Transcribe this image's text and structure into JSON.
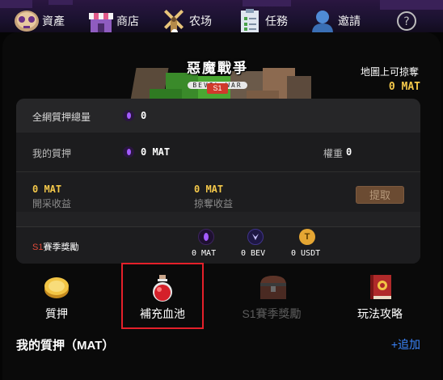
{
  "nav": {
    "items": [
      {
        "label": "資產",
        "icon": "skull-icon"
      },
      {
        "label": "商店",
        "icon": "shop-icon"
      },
      {
        "label": "农场",
        "icon": "windmill-icon"
      },
      {
        "label": "任務",
        "icon": "checklist-icon"
      },
      {
        "label": "邀請",
        "icon": "user-icon"
      }
    ],
    "active_index": 2,
    "help_icon": "help-icon"
  },
  "map": {
    "title": "惡魔戰爭",
    "subtitle": "BEVIL WAR",
    "season_tag": "S1"
  },
  "plunder": {
    "label": "地圖上可掠奪",
    "value": "0 MAT"
  },
  "stats": {
    "total_stake_label": "全網質押總量",
    "total_stake_value": "0",
    "my_stake_label": "我的質押",
    "my_stake_value": "0 MAT",
    "weight_label": "權重",
    "weight_value": "0",
    "mining_value": "0 MAT",
    "mining_label": "開采收益",
    "plunder_value": "0 MAT",
    "plunder_label": "掠奪收益",
    "claim_label": "提取"
  },
  "season_reward": {
    "label_prefix": "S1",
    "label_suffix": "賽季獎勵",
    "items": [
      {
        "value": "0 MAT",
        "icon": "mat-coin-icon"
      },
      {
        "value": "0 BEV",
        "icon": "bev-coin-icon"
      },
      {
        "value": "0 USDT",
        "icon": "usdt-coin-icon",
        "glyph": "T"
      }
    ]
  },
  "actions": [
    {
      "label": "質押",
      "icon": "gold-coin-icon",
      "enabled": true
    },
    {
      "label": "補充血池",
      "icon": "potion-icon",
      "enabled": true
    },
    {
      "label": "S1賽季獎勵",
      "icon": "treasure-chest-icon",
      "enabled": false
    },
    {
      "label": "玩法攻略",
      "icon": "guide-book-icon",
      "enabled": true
    }
  ],
  "footer": {
    "my_stake_title": "我的質押（MAT）",
    "add_label": "+追加"
  },
  "colors": {
    "gold": "#f4c84a",
    "highlight_border": "#e5202a",
    "link": "#3b86ff",
    "season_red": "#e04a3a"
  }
}
